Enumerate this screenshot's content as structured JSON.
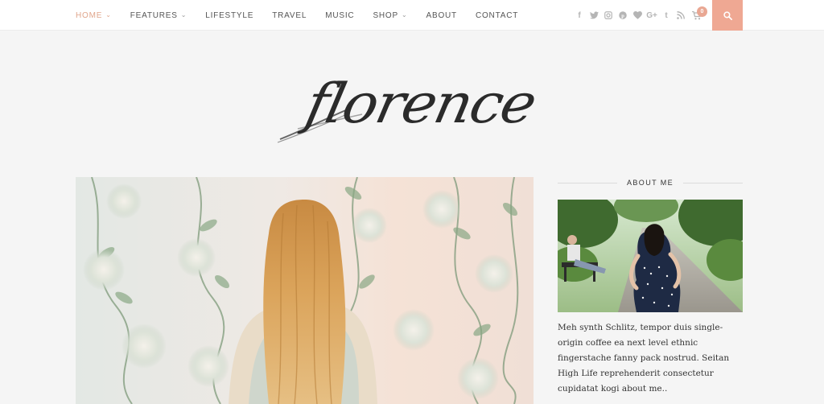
{
  "nav": {
    "items": [
      {
        "label": "Home",
        "active": true,
        "dropdown": true
      },
      {
        "label": "Features",
        "active": false,
        "dropdown": true
      },
      {
        "label": "Lifestyle",
        "active": false,
        "dropdown": false
      },
      {
        "label": "Travel",
        "active": false,
        "dropdown": false
      },
      {
        "label": "Music",
        "active": false,
        "dropdown": false
      },
      {
        "label": "Shop",
        "active": false,
        "dropdown": true
      },
      {
        "label": "About",
        "active": false,
        "dropdown": false
      },
      {
        "label": "Contact",
        "active": false,
        "dropdown": false
      }
    ],
    "chevron": "⌄"
  },
  "social": {
    "icons": [
      "facebook-icon",
      "twitter-icon",
      "instagram-icon",
      "pinterest-icon",
      "bloglovin-heart-icon",
      "google-plus-icon",
      "tumblr-icon",
      "rss-icon"
    ],
    "glyphs": {
      "facebook": "f",
      "google_plus": "G+",
      "tumblr": "t"
    }
  },
  "cart": {
    "count": "0"
  },
  "logo": {
    "text": "florence"
  },
  "sidebar": {
    "about": {
      "title": "ABOUT ME",
      "text": "Meh synth Schlitz, tempor duis single-origin coffee ea next level ethnic fingerstache fanny pack nostrud. Seitan High Life reprehenderit consectetur cupidatat kogi about me.."
    }
  },
  "colors": {
    "accent": "#efa893",
    "nav_active": "#e0a58b",
    "icon_gray": "#b5b5b5"
  }
}
